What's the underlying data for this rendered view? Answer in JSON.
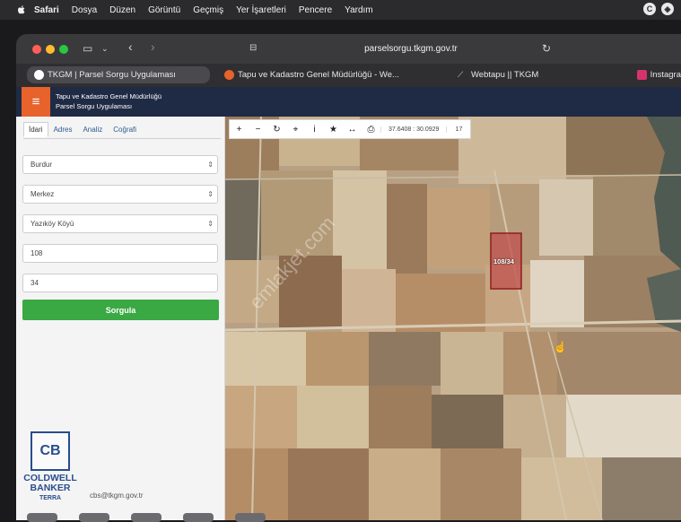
{
  "menubar": {
    "items": [
      "Safari",
      "Dosya",
      "Düzen",
      "Görüntü",
      "Geçmiş",
      "Yer İşaretleri",
      "Pencere",
      "Yardım"
    ]
  },
  "browser": {
    "url": "parselsorgu.tkgm.gov.tr",
    "tabs": [
      {
        "label": "TKGM | Parsel Sorgu Uygulaması",
        "active": true
      },
      {
        "label": "Tapu ve Kadastro Genel Müdürlüğü - We...",
        "active": false
      },
      {
        "label": "Webtapu || TKGM",
        "active": false
      },
      {
        "label": "Instagra",
        "active": false
      }
    ]
  },
  "header": {
    "line1": "Tapu ve Kadastro Genel Müdürlüğü",
    "line2": "Parsel Sorgu Uygulaması",
    "menu_icon": "hamburger-icon"
  },
  "panel": {
    "tabs": [
      "İdari",
      "Adres",
      "Analiz",
      "Coğrafi"
    ],
    "il": "Burdur",
    "ilce": "Merkez",
    "mahalle": "Yazıköy Köyü",
    "ada": "108",
    "parsel": "34",
    "submit": "Sorgula",
    "email": "cbs@tkgm.gov.tr"
  },
  "map": {
    "coordinate": "37.6408 : 30.0929",
    "zoom": "17",
    "parcel_label": "108/34",
    "watermark": "emlakjet.com"
  },
  "logo": {
    "line1": "COLDWELL",
    "line2": "BANKER",
    "line3": "TERRA"
  },
  "colors": {
    "header_bg": "#1f2a44",
    "menu_button": "#e8622c",
    "submit_green": "#3aa843",
    "parcel_fill": "#c0504d"
  }
}
